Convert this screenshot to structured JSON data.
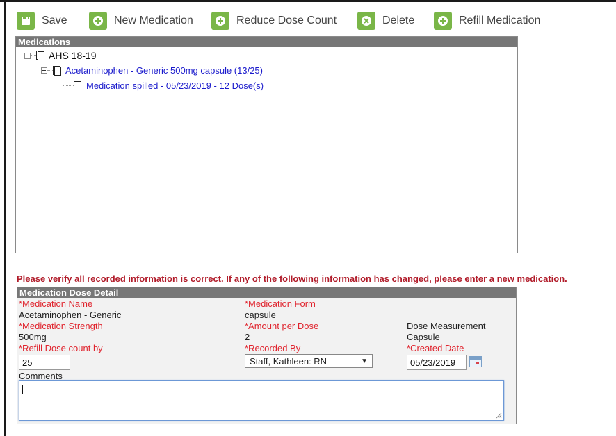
{
  "toolbar": {
    "save_label": "Save",
    "new_medication_label": "New Medication",
    "reduce_dose_label": "Reduce Dose Count",
    "delete_label": "Delete",
    "refill_label": "Refill Medication"
  },
  "medications_panel": {
    "title": "Medications",
    "tree": {
      "root": "AHS 18-19",
      "medication": "Acetaminophen - Generic 500mg capsule (13/25)",
      "event": "Medication spilled - 05/23/2019 - 12 Dose(s)"
    }
  },
  "warning_text": "Please verify all recorded information is correct. If any of the following information has changed, please enter a new medication.",
  "detail": {
    "title": "Medication Dose Detail",
    "medication_name_label": "*Medication Name",
    "medication_name_value": "Acetaminophen - Generic",
    "medication_form_label": "*Medication Form",
    "medication_form_value": "capsule",
    "medication_strength_label": "*Medication Strength",
    "medication_strength_value": "500mg",
    "amount_per_dose_label": "*Amount per Dose",
    "amount_per_dose_value": "2",
    "dose_measurement_label": "Dose Measurement",
    "dose_measurement_value": "Capsule",
    "refill_dose_count_label": "*Refill Dose count by",
    "refill_dose_count_value": "25",
    "recorded_by_label": "*Recorded By",
    "recorded_by_value": "Staff, Kathleen: RN",
    "created_date_label": "*Created Date",
    "created_date_value": "05/23/2019",
    "comments_label": "Comments",
    "comments_value": ""
  },
  "colors": {
    "toolbar_icon": "#7ab648",
    "panel_header": "#777777",
    "required_label": "#e0242e",
    "warning": "#b11c2a",
    "tree_link": "#1a1acc"
  }
}
